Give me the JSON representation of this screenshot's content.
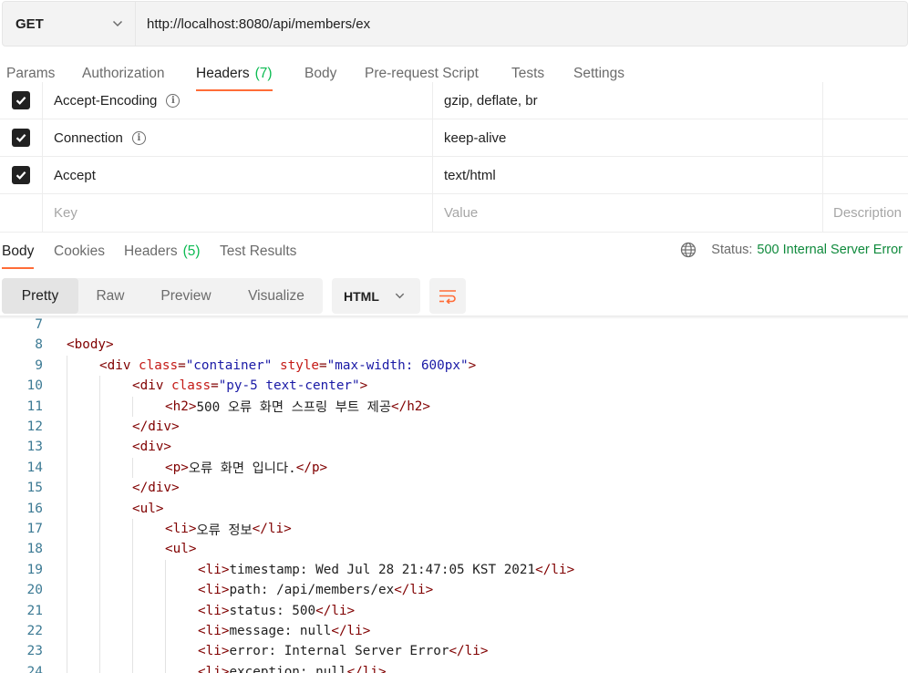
{
  "request": {
    "method": "GET",
    "url": "http://localhost:8080/api/members/ex"
  },
  "request_tabs": [
    {
      "label": "Params"
    },
    {
      "label": "Authorization"
    },
    {
      "label": "Headers",
      "count": "(7)"
    },
    {
      "label": "Body"
    },
    {
      "label": "Pre-request Script"
    },
    {
      "label": "Tests"
    },
    {
      "label": "Settings"
    }
  ],
  "headers_table": {
    "rows": [
      {
        "key": "Accept-Encoding",
        "value": "gzip, deflate, br",
        "checked": true,
        "info": true
      },
      {
        "key": "Connection",
        "value": "keep-alive",
        "checked": true,
        "info": true
      },
      {
        "key": "Accept",
        "value": "text/html",
        "checked": true,
        "info": false
      }
    ],
    "placeholder": {
      "key": "Key",
      "value": "Value",
      "description": "Description"
    }
  },
  "response_tabs": [
    {
      "label": "Body"
    },
    {
      "label": "Cookies"
    },
    {
      "label": "Headers",
      "count": "(5)"
    },
    {
      "label": "Test Results"
    }
  ],
  "response_status": {
    "label": "Status:",
    "value": "500 Internal Server Error"
  },
  "view_modes": [
    "Pretty",
    "Raw",
    "Preview",
    "Visualize"
  ],
  "format": "HTML",
  "code_lines": [
    {
      "n": "7",
      "indent": 0,
      "parts": []
    },
    {
      "n": "8",
      "indent": 0,
      "parts": [
        [
          "t",
          "<body>"
        ]
      ]
    },
    {
      "n": "9",
      "indent": 1,
      "parts": [
        [
          "t",
          "<div "
        ],
        [
          "a",
          "class"
        ],
        [
          "t",
          "="
        ],
        [
          "v",
          "\"container\""
        ],
        [
          "t",
          " "
        ],
        [
          "a",
          "style"
        ],
        [
          "t",
          "="
        ],
        [
          "v",
          "\"max-width: 600px\""
        ],
        [
          "t",
          ">"
        ]
      ]
    },
    {
      "n": "10",
      "indent": 2,
      "parts": [
        [
          "t",
          "<div "
        ],
        [
          "a",
          "class"
        ],
        [
          "t",
          "="
        ],
        [
          "v",
          "\"py-5 text-center\""
        ],
        [
          "t",
          ">"
        ]
      ]
    },
    {
      "n": "11",
      "indent": 3,
      "parts": [
        [
          "t",
          "<h2>"
        ],
        [
          "tx",
          "500 오류 화면 스프링 부트 제공"
        ],
        [
          "t",
          "</h2>"
        ]
      ]
    },
    {
      "n": "12",
      "indent": 2,
      "parts": [
        [
          "t",
          "</div>"
        ]
      ]
    },
    {
      "n": "13",
      "indent": 2,
      "parts": [
        [
          "t",
          "<div>"
        ]
      ]
    },
    {
      "n": "14",
      "indent": 3,
      "parts": [
        [
          "t",
          "<p>"
        ],
        [
          "tx",
          "오류 화면 입니다."
        ],
        [
          "t",
          "</p>"
        ]
      ]
    },
    {
      "n": "15",
      "indent": 2,
      "parts": [
        [
          "t",
          "</div>"
        ]
      ]
    },
    {
      "n": "16",
      "indent": 2,
      "parts": [
        [
          "t",
          "<ul>"
        ]
      ]
    },
    {
      "n": "17",
      "indent": 3,
      "parts": [
        [
          "t",
          "<li>"
        ],
        [
          "tx",
          "오류 정보"
        ],
        [
          "t",
          "</li>"
        ]
      ]
    },
    {
      "n": "18",
      "indent": 3,
      "parts": [
        [
          "t",
          "<ul>"
        ]
      ]
    },
    {
      "n": "19",
      "indent": 4,
      "parts": [
        [
          "t",
          "<li>"
        ],
        [
          "tx",
          "timestamp: Wed Jul 28 21:47:05 KST 2021"
        ],
        [
          "t",
          "</li>"
        ]
      ]
    },
    {
      "n": "20",
      "indent": 4,
      "parts": [
        [
          "t",
          "<li>"
        ],
        [
          "tx",
          "path: /api/members/ex"
        ],
        [
          "t",
          "</li>"
        ]
      ]
    },
    {
      "n": "21",
      "indent": 4,
      "parts": [
        [
          "t",
          "<li>"
        ],
        [
          "tx",
          "status: 500"
        ],
        [
          "t",
          "</li>"
        ]
      ]
    },
    {
      "n": "22",
      "indent": 4,
      "parts": [
        [
          "t",
          "<li>"
        ],
        [
          "tx",
          "message: null"
        ],
        [
          "t",
          "</li>"
        ]
      ]
    },
    {
      "n": "23",
      "indent": 4,
      "parts": [
        [
          "t",
          "<li>"
        ],
        [
          "tx",
          "error: Internal Server Error"
        ],
        [
          "t",
          "</li>"
        ]
      ]
    },
    {
      "n": "24",
      "indent": 4,
      "parts": [
        [
          "t",
          "<li>"
        ],
        [
          "tx",
          "exception: null"
        ],
        [
          "t",
          "</li>"
        ]
      ]
    }
  ]
}
